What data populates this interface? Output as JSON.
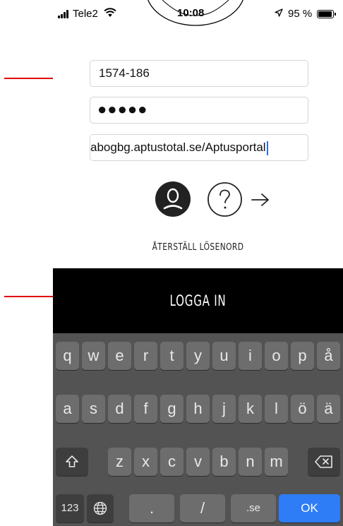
{
  "status_bar": {
    "carrier": "Tele2",
    "time": "10:08",
    "battery": "95 %"
  },
  "login_form": {
    "username_value": "1574-186",
    "password_value": "●●●●●",
    "url_value": "abogbg.aptustotal.se/Aptusportal"
  },
  "links": {
    "reset_password": "ÅTERSTÄLL LÖSENORD"
  },
  "login_button": {
    "label": "LOGGA IN"
  },
  "keyboard": {
    "row1": [
      "q",
      "w",
      "e",
      "r",
      "t",
      "y",
      "u",
      "i",
      "o",
      "p",
      "å"
    ],
    "row2": [
      "a",
      "s",
      "d",
      "f",
      "g",
      "h",
      "j",
      "k",
      "l",
      "ö",
      "ä"
    ],
    "row3": [
      "z",
      "x",
      "c",
      "v",
      "b",
      "n",
      "m"
    ],
    "numbers_key": "123",
    "period_key": ".",
    "slash_key": "/",
    "domain_key": ".se",
    "ok_key": "OK"
  },
  "colors": {
    "annotation_arrow": "#e00000",
    "ok_key": "#2e7cf6",
    "login_bar": "#000000",
    "keyboard_bg": "#535353"
  }
}
